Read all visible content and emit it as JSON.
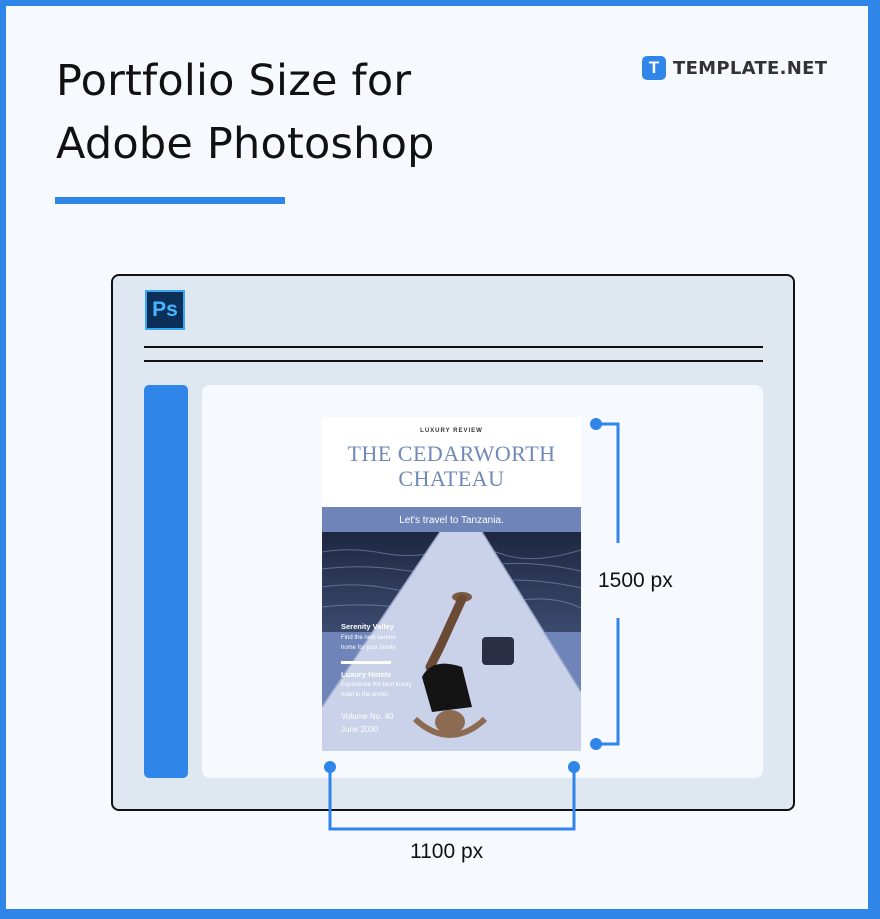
{
  "title": {
    "line1": "Portfolio Size for",
    "line2": "Adobe Photoshop"
  },
  "logo": {
    "mark": "T",
    "text": "TEMPLATE.NET"
  },
  "app": {
    "icon_label": "Ps"
  },
  "cover": {
    "kicker": "LUXURY REVIEW",
    "title_line1": "THE CEDARWORTH",
    "title_line2": "CHATEAU",
    "tagline": "Let's travel to Tanzania.",
    "section1_title": "Serenity Valley",
    "section1_text_line1": "Find the next serene",
    "section1_text_line2": "home for your family.",
    "section2_title": "Luxury Hotels",
    "section2_text_line1": "Experience the best luxury",
    "section2_text_line2": "hotel in the world!",
    "volume": "Volume No. 40",
    "date": "June 2030"
  },
  "dimensions": {
    "height_label": "1500 px",
    "width_label": "1100 px"
  },
  "colors": {
    "accent": "#2f86e8",
    "window_bg": "#dfe7f1",
    "cover_title": "#7189b7",
    "cover_overlay": "#6f84b8"
  }
}
